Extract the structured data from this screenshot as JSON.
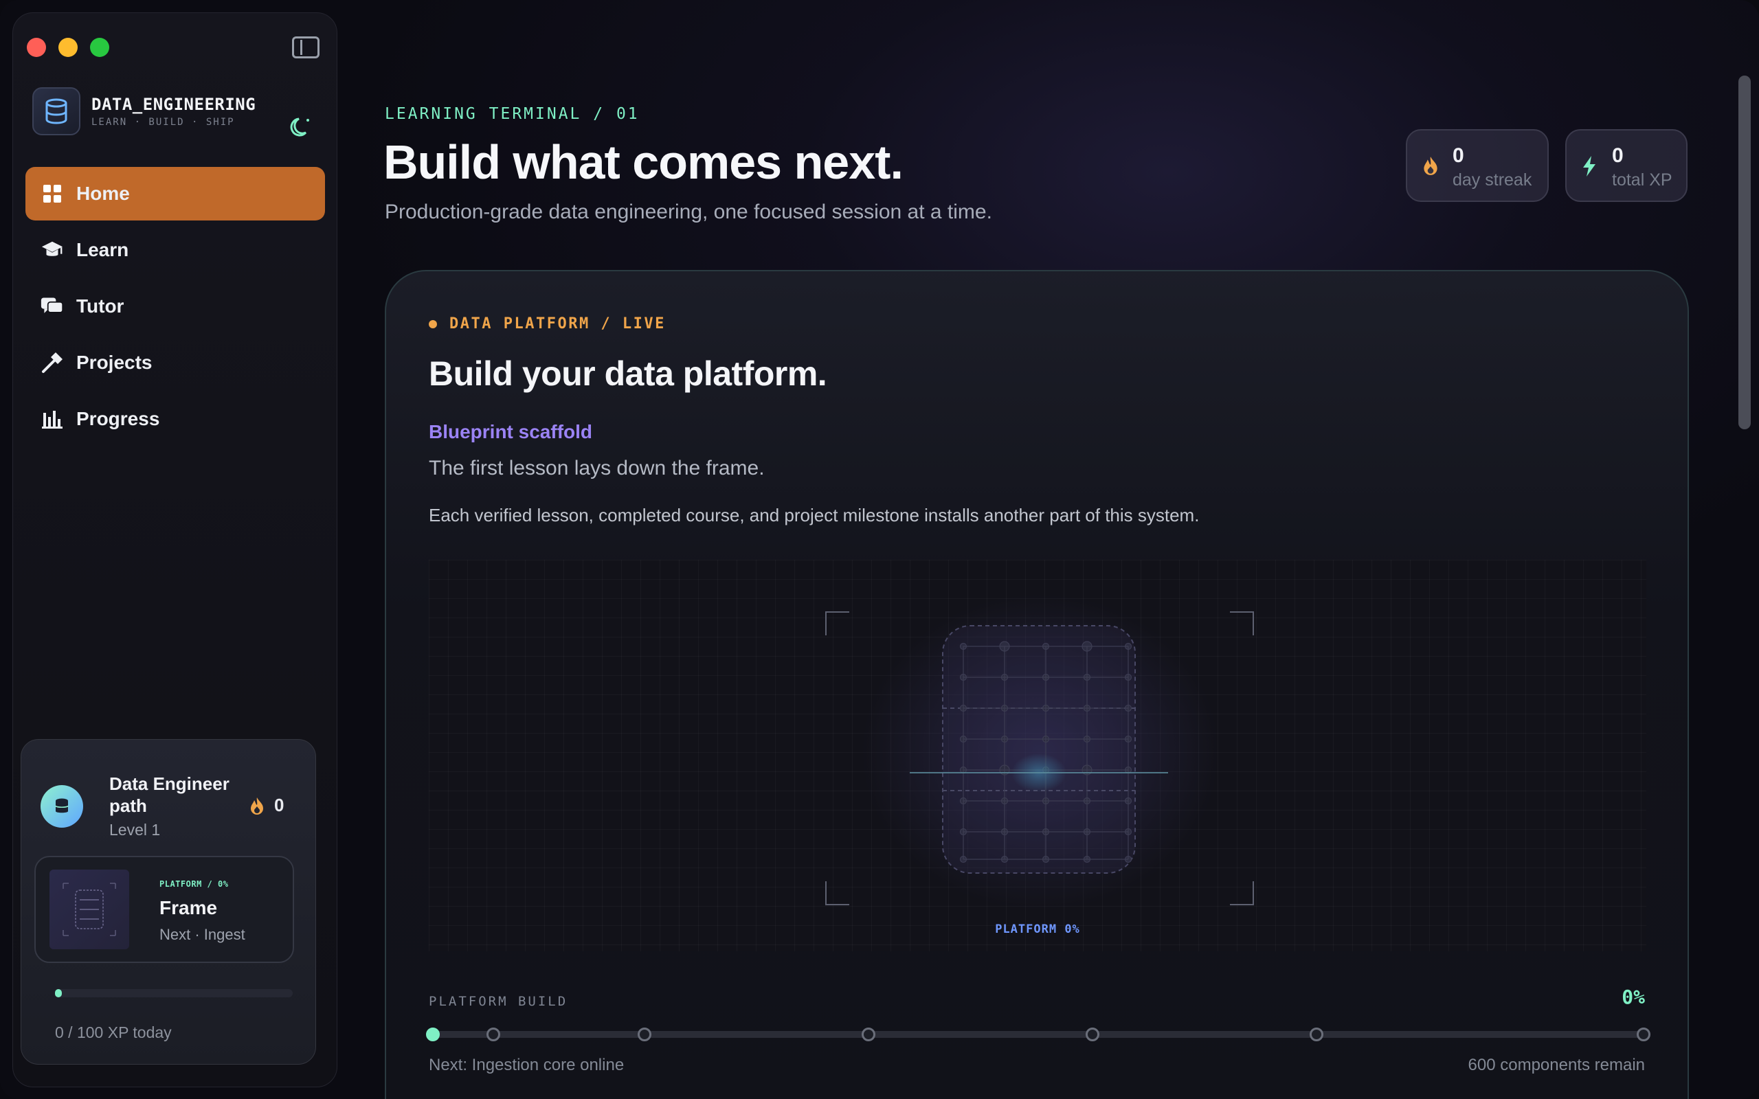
{
  "brand": {
    "name": "DATA_ENGINEERING",
    "tagline": "LEARN · BUILD · SHIP"
  },
  "nav": {
    "items": [
      {
        "label": "Home",
        "icon": "grid-icon",
        "active": true
      },
      {
        "label": "Learn",
        "icon": "graduation-cap-icon"
      },
      {
        "label": "Tutor",
        "icon": "chat-bubbles-icon"
      },
      {
        "label": "Projects",
        "icon": "hammer-icon"
      },
      {
        "label": "Progress",
        "icon": "bar-chart-icon"
      }
    ]
  },
  "profile": {
    "path_name": "Data Engineer path",
    "level": "Level 1",
    "streak": "0",
    "current": {
      "tag": "PLATFORM / 0%",
      "title": "Frame",
      "next": "Next · Ingest"
    },
    "xp_today": "0 / 100 XP today",
    "xp_fraction": 0
  },
  "header": {
    "tag": "LEARNING TERMINAL / 01",
    "title": "Build what comes next.",
    "subtitle": "Production-grade data engineering, one focused session at a time."
  },
  "stats": {
    "streak": {
      "value": "0",
      "label": "day streak"
    },
    "xp": {
      "value": "0",
      "label": "total XP"
    }
  },
  "platform": {
    "live_tag": "DATA PLATFORM / LIVE",
    "title": "Build your data platform.",
    "kicker": "Blueprint scaffold",
    "line1": "The first lesson lays down the frame.",
    "line2": "Each verified lesson, completed course, and project milestone installs another part of this system.",
    "canvas_label": "PLATFORM 0%",
    "build_label": "PLATFORM BUILD",
    "build_percent": "0%",
    "build_fraction": 0,
    "milestones": 7,
    "next": "Next: Ingestion core online",
    "remaining": "600 components remain"
  },
  "colors": {
    "accent": "#c0692a",
    "mint": "#7ff0c5",
    "violet": "#9b83f5",
    "amber": "#f0a54a"
  }
}
